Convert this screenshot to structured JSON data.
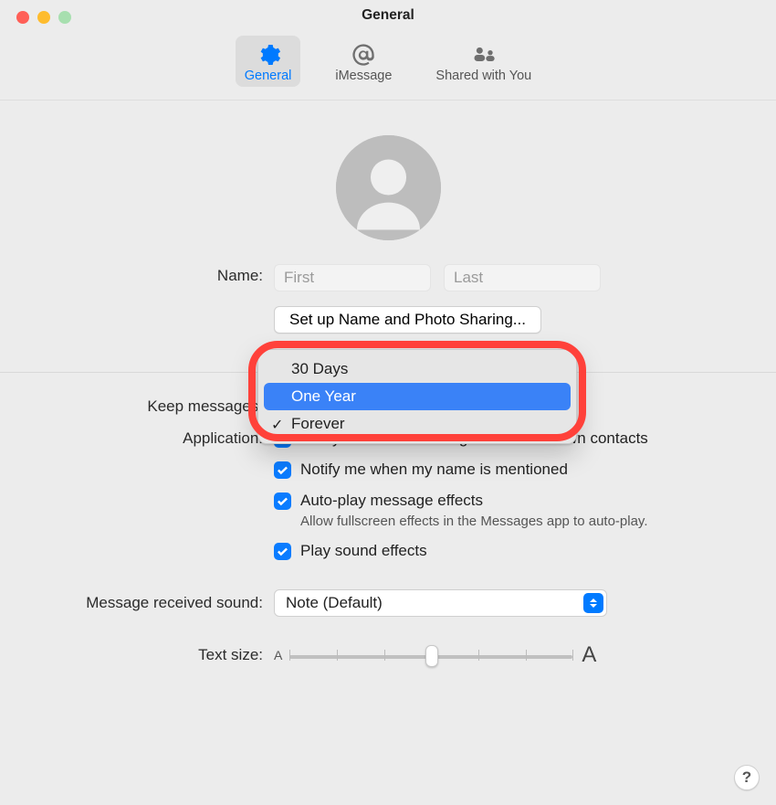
{
  "window": {
    "title": "General"
  },
  "tabs": {
    "general": "General",
    "imessage": "iMessage",
    "shared": "Shared with You",
    "selected": "general"
  },
  "form": {
    "name_label": "Name:",
    "first_placeholder": "First",
    "last_placeholder": "Last",
    "setup_button": "Set up Name and Photo Sharing...",
    "keep_label": "Keep messages:",
    "keep_menu": {
      "options": [
        "30 Days",
        "One Year",
        "Forever"
      ],
      "highlighted": "One Year",
      "checked": "Forever"
    },
    "application_label": "Application:",
    "app_checks": {
      "unknown": {
        "label": "Notify me about messages from unknown contacts",
        "checked": true
      },
      "mentioned": {
        "label": "Notify me when my name is mentioned",
        "checked": true
      },
      "effects": {
        "label": "Auto-play message effects",
        "checked": true,
        "sub": "Allow fullscreen effects in the Messages app to auto-play."
      },
      "sound": {
        "label": "Play sound effects",
        "checked": true
      }
    },
    "sound_label": "Message received sound:",
    "sound_value": "Note (Default)",
    "textsize_label": "Text size:",
    "textsize_small": "A",
    "textsize_big": "A",
    "slider": {
      "min": 0,
      "max": 6,
      "value": 3
    }
  },
  "help": "?"
}
